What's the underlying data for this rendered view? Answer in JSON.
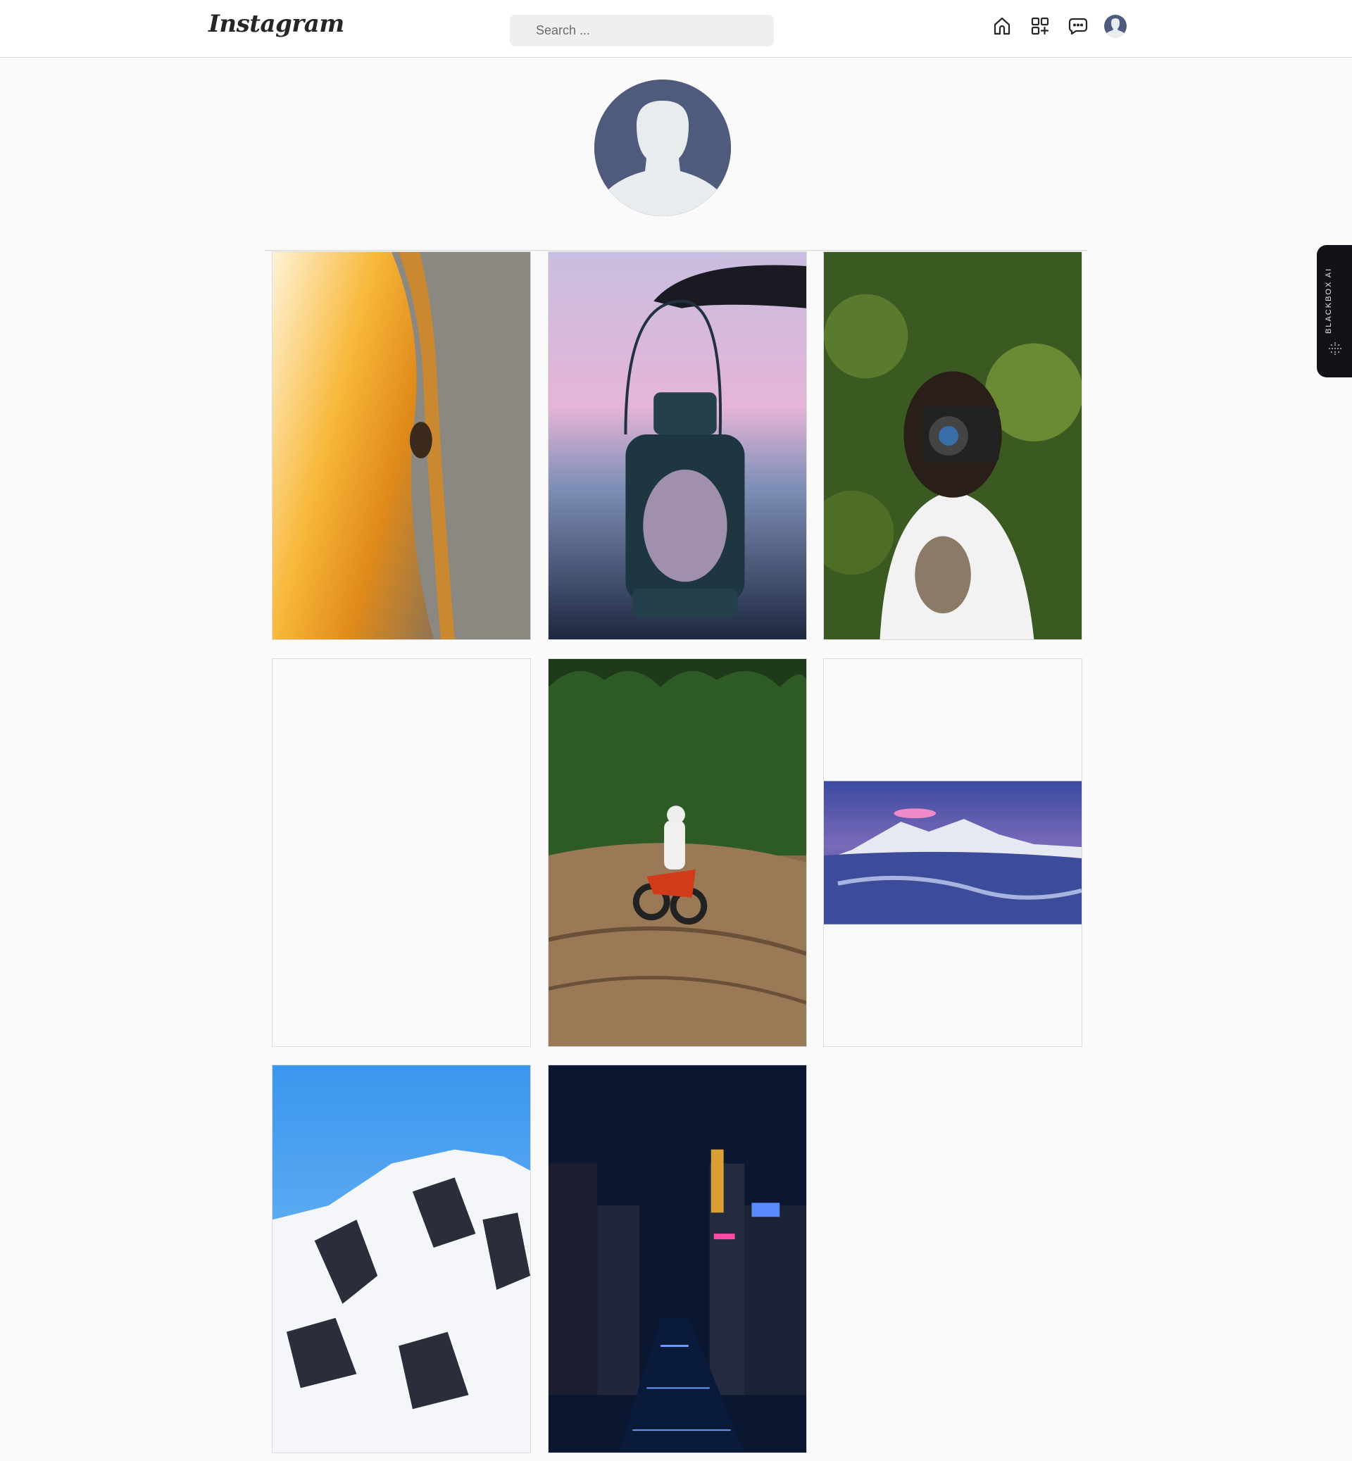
{
  "header": {
    "logo_text": "Instagram",
    "search_placeholder": "Search ...",
    "icons": [
      "home-icon",
      "add-post-icon",
      "messages-icon",
      "profile-avatar-icon"
    ]
  },
  "profile": {
    "avatar_icon": "default-user-avatar"
  },
  "posts": [
    {
      "subject": "horse-closeup-photo"
    },
    {
      "subject": "lantern-photo"
    },
    {
      "subject": "photographer-with-camera-photo"
    },
    {
      "subject": "empty-post"
    },
    {
      "subject": "motocross-rider-photo"
    },
    {
      "subject": "snowy-mountain-landscape-photo"
    },
    {
      "subject": "snowy-peak-blue-sky-photo"
    },
    {
      "subject": "night-city-canal-photo"
    }
  ],
  "side_tab": {
    "label": "BLACKBOX AI"
  },
  "colors": {
    "header_bg": "#ffffff",
    "page_bg": "#fafafa",
    "avatar_bg": "#4f5b7d",
    "side_tab_bg": "#111318"
  }
}
